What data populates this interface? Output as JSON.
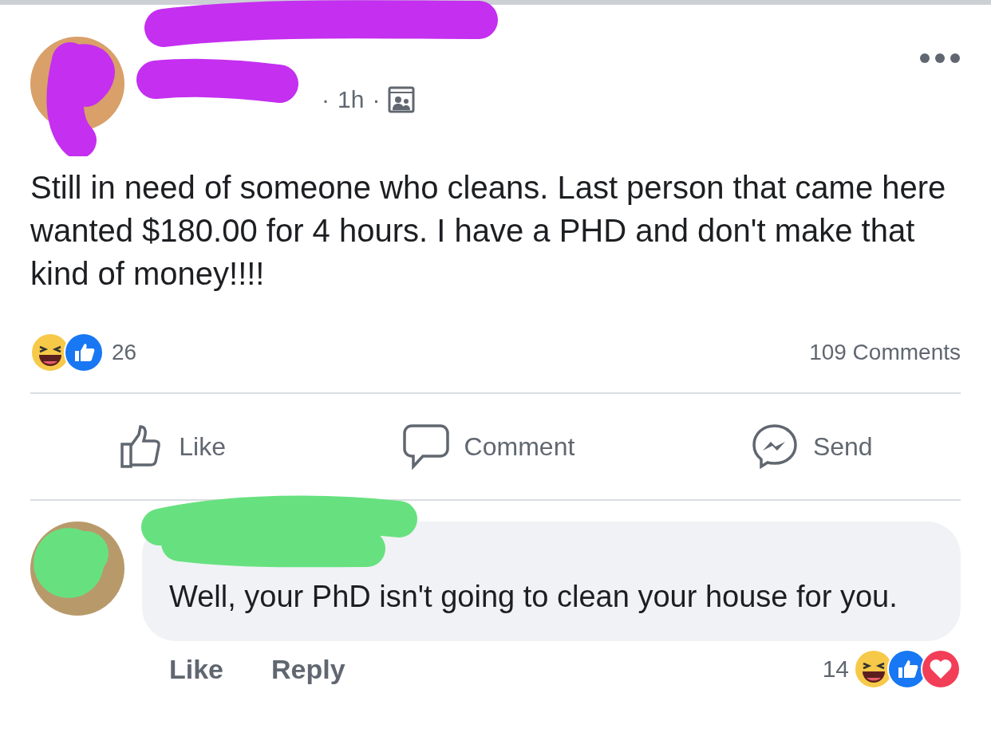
{
  "post": {
    "meta": {
      "sep1": "·",
      "time": "1h",
      "sep2": "·"
    },
    "text": "Still in need of someone who cleans. Last person that came here wanted $180.00 for 4 hours. I have a PHD and don't make that kind of money!!!!",
    "reaction_count": "26",
    "comments_count": "109 Comments",
    "actions": [
      {
        "kind": "like",
        "label": "Like"
      },
      {
        "kind": "comment",
        "label": "Comment"
      },
      {
        "kind": "send",
        "label": "Send"
      }
    ]
  },
  "comment": {
    "text": "Well, your PhD isn't going to clean your house for you.",
    "actions": [
      "Like",
      "Reply"
    ],
    "reaction_count": "14"
  }
}
